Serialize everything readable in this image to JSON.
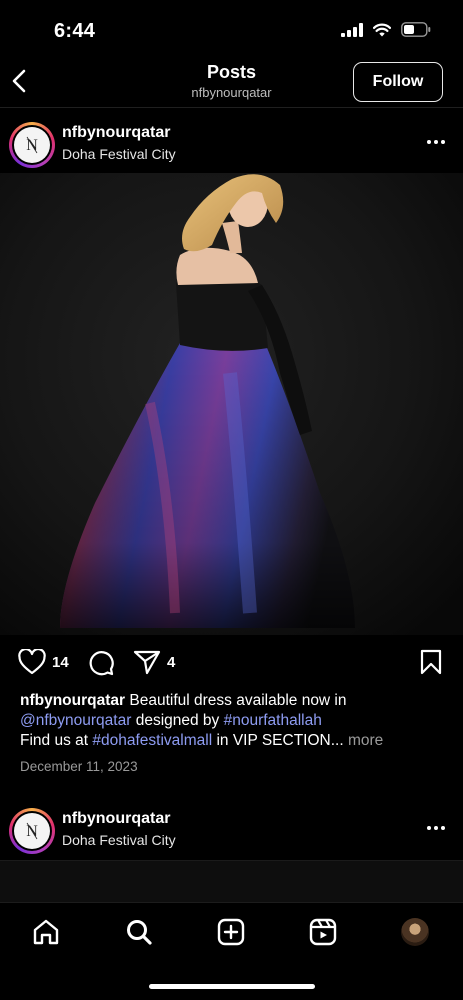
{
  "status_bar": {
    "time": "6:44",
    "icons": [
      "cellular-signal-icon",
      "wifi-icon",
      "battery-icon"
    ]
  },
  "header": {
    "title": "Posts",
    "subtitle": "nfbynourqatar",
    "follow_label": "Follow",
    "back_icon": "chevron-left-icon"
  },
  "posts": [
    {
      "username": "nfbynourqatar",
      "location": "Doha Festival City",
      "avatar_text": "N",
      "likes": "14",
      "shares": "4",
      "caption": {
        "username": "nfbynourqatar",
        "text1": " Beautiful dress available now in ",
        "mention": "@nfbynourqatar",
        "text2": " designed by ",
        "hashtag1": "#nourfathallah",
        "text3": "Find us at ",
        "hashtag2": "#dohafestivalmall",
        "text4": " in VIP SECTION...",
        "more": " more"
      },
      "date": "December 11, 2023"
    },
    {
      "username": "nfbynourqatar",
      "location": "Doha Festival City",
      "avatar_text": "N"
    }
  ],
  "tabbar": {
    "items": [
      "home-icon",
      "search-icon",
      "create-icon",
      "reels-icon",
      "profile-avatar"
    ]
  },
  "colors": {
    "background": "#000000",
    "link": "#8e9cf2",
    "muted": "#9a9a9a",
    "story_ring": [
      "#f7b14a",
      "#e1306c",
      "#7a2fd6"
    ]
  }
}
